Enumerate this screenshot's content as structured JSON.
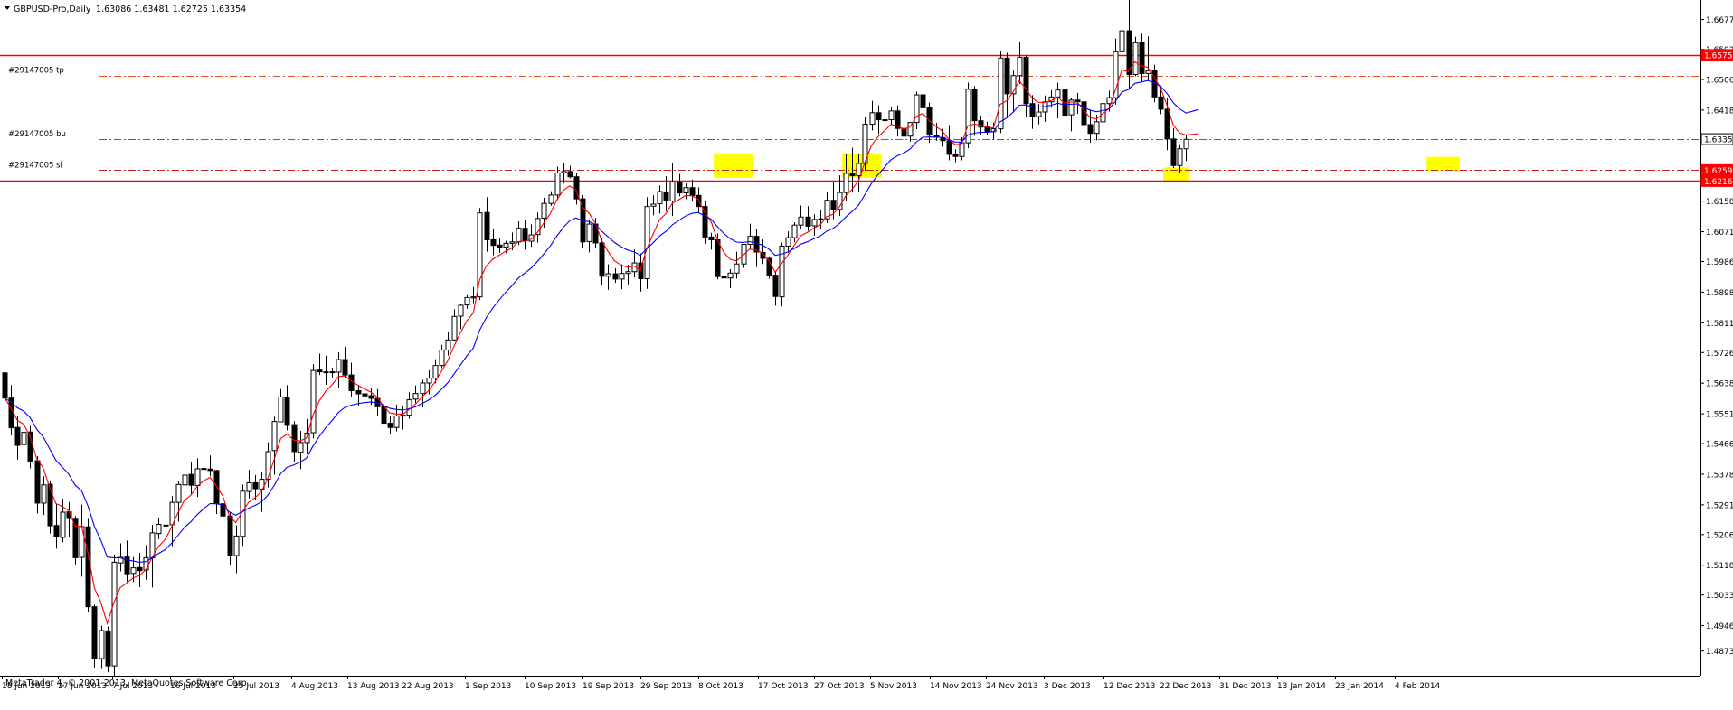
{
  "window": {
    "symbol_label": "GBPUSD-Pro,Daily",
    "ohlc_readout": "1.63086 1.63481 1.62725 1.63354",
    "copyright": "MetaTrader 4, © 2001-2013, MetaQuotes Software Corp."
  },
  "colors": {
    "background": "#ffffff",
    "candle": "#000000",
    "ma_fast": "#ff0000",
    "ma_slow": "#0000ff",
    "hline": "#ff0000",
    "tp_line": "#e05020",
    "bid_line": "#2a8a2a",
    "sl_line": "#cc2020",
    "highlight": "#ffff00",
    "price_badge": "#ff0000"
  },
  "chart_data": {
    "type": "candlestick",
    "symbol": "GBPUSD-Pro",
    "timeframe": "Daily",
    "y_range": [
      1.4803,
      1.6733
    ],
    "y_ticks": [
      "1.66775",
      "1.65920",
      "1.65060",
      "1.64185",
      "1.63354",
      "1.62591",
      "1.62160",
      "1.61585",
      "1.60710",
      "1.59860",
      "1.58985",
      "1.58110",
      "1.57260",
      "1.56385",
      "1.55510",
      "1.54660",
      "1.53785",
      "1.52910",
      "1.52060",
      "1.51185",
      "1.50335",
      "1.49460",
      "1.48735"
    ],
    "x_ticks": [
      "18 Jun 2013",
      "27 Jun 2013",
      "7 Jul 2013",
      "16 Jul 2013",
      "25 Jul 2013",
      "4 Aug 2013",
      "13 Aug 2013",
      "22 Aug 2013",
      "1 Sep 2013",
      "10 Sep 2013",
      "19 Sep 2013",
      "29 Sep 2013",
      "8 Oct 2013",
      "17 Oct 2013",
      "27 Oct 2013",
      "5 Nov 2013",
      "14 Nov 2013",
      "24 Nov 2013",
      "3 Dec 2013",
      "12 Dec 2013",
      "22 Dec 2013",
      "31 Dec 2013",
      "13 Jan 2014",
      "23 Jan 2014",
      "4 Feb 2014"
    ],
    "horizontal_lines": [
      {
        "price": 1.65759,
        "style": "solid",
        "badge": "1.65759"
      },
      {
        "price": 1.6216,
        "style": "solid",
        "badge": "1.62160"
      },
      {
        "price": 1.6517,
        "style": "dashdot",
        "label": "#29147005 tp"
      },
      {
        "price": 1.63354,
        "style": "dashdot",
        "label": "#29147005 bu",
        "badge": "1.63354"
      },
      {
        "price": 1.6247,
        "style": "dashdot",
        "label": "#29147005 sl",
        "badge": "1.62591"
      }
    ],
    "moving_averages": [
      {
        "period": 5,
        "color_key": "ma_fast"
      },
      {
        "period": 14,
        "color_key": "ma_slow"
      }
    ],
    "highlight_zones": [
      {
        "from_index": 111,
        "to_index": 116,
        "low": 1.6225,
        "high": 1.6295
      },
      {
        "from_index": 131,
        "to_index": 136,
        "low": 1.6225,
        "high": 1.6295
      },
      {
        "from_index": 181,
        "to_index": 184,
        "low": 1.6215,
        "high": 1.6255
      },
      {
        "from_index": 222,
        "to_index": 226,
        "low": 1.6245,
        "high": 1.6285
      }
    ],
    "candles": [
      [
        1.5668,
        1.572,
        1.5585,
        1.5596
      ],
      [
        1.5596,
        1.5633,
        1.5489,
        1.5511
      ],
      [
        1.5512,
        1.5546,
        1.542,
        1.5461
      ],
      [
        1.5463,
        1.553,
        1.5416,
        1.5498
      ],
      [
        1.5499,
        1.5516,
        1.5395,
        1.5416
      ],
      [
        1.5417,
        1.543,
        1.5266,
        1.5296
      ],
      [
        1.5296,
        1.5373,
        1.5262,
        1.5348
      ],
      [
        1.535,
        1.536,
        1.5209,
        1.5231
      ],
      [
        1.5232,
        1.5295,
        1.5166,
        1.5199
      ],
      [
        1.5198,
        1.5308,
        1.5184,
        1.527
      ],
      [
        1.5271,
        1.5299,
        1.52,
        1.5252
      ],
      [
        1.525,
        1.5259,
        1.5121,
        1.514
      ],
      [
        1.5141,
        1.5292,
        1.5086,
        1.5229
      ],
      [
        1.5228,
        1.5251,
        1.4985,
        1.5
      ],
      [
        1.5,
        1.5006,
        1.4825,
        1.4853
      ],
      [
        1.4852,
        1.4946,
        1.4822,
        1.4932
      ],
      [
        1.4931,
        1.4944,
        1.4813,
        1.4831
      ],
      [
        1.4831,
        1.5149,
        1.4798,
        1.5127
      ],
      [
        1.5125,
        1.5181,
        1.5101,
        1.5141
      ],
      [
        1.5142,
        1.5189,
        1.5071,
        1.5094
      ],
      [
        1.5095,
        1.5142,
        1.5071,
        1.5111
      ],
      [
        1.5112,
        1.5154,
        1.5056,
        1.5103
      ],
      [
        1.5105,
        1.5176,
        1.5077,
        1.514
      ],
      [
        1.514,
        1.5234,
        1.5055,
        1.5211
      ],
      [
        1.5209,
        1.5254,
        1.5193,
        1.5235
      ],
      [
        1.5233,
        1.5242,
        1.5186,
        1.5231
      ],
      [
        1.5234,
        1.5316,
        1.5173,
        1.5298
      ],
      [
        1.5298,
        1.5358,
        1.5243,
        1.5349
      ],
      [
        1.5348,
        1.5398,
        1.5274,
        1.5376
      ],
      [
        1.5378,
        1.5413,
        1.5321,
        1.5347
      ],
      [
        1.5346,
        1.5424,
        1.5314,
        1.5394
      ],
      [
        1.5395,
        1.5423,
        1.537,
        1.5392
      ],
      [
        1.5393,
        1.5432,
        1.5373,
        1.5389
      ],
      [
        1.5389,
        1.5391,
        1.5265,
        1.5294
      ],
      [
        1.5294,
        1.5315,
        1.5234,
        1.5259
      ],
      [
        1.5259,
        1.5271,
        1.5119,
        1.5147
      ],
      [
        1.5146,
        1.5232,
        1.5096,
        1.5202
      ],
      [
        1.5201,
        1.5349,
        1.5174,
        1.533
      ],
      [
        1.5329,
        1.5391,
        1.5309,
        1.5354
      ],
      [
        1.5354,
        1.5376,
        1.5304,
        1.5337
      ],
      [
        1.5336,
        1.5385,
        1.5271,
        1.5364
      ],
      [
        1.5364,
        1.547,
        1.5341,
        1.5443
      ],
      [
        1.5446,
        1.5543,
        1.5377,
        1.5529
      ],
      [
        1.5528,
        1.5622,
        1.5528,
        1.5599
      ],
      [
        1.5598,
        1.5633,
        1.5504,
        1.5518
      ],
      [
        1.552,
        1.553,
        1.5414,
        1.5443
      ],
      [
        1.5441,
        1.5502,
        1.5393,
        1.5469
      ],
      [
        1.5469,
        1.5536,
        1.5435,
        1.5496
      ],
      [
        1.5497,
        1.5693,
        1.5481,
        1.5675
      ],
      [
        1.5676,
        1.5723,
        1.5662,
        1.5671
      ],
      [
        1.567,
        1.5717,
        1.5634,
        1.5671
      ],
      [
        1.5671,
        1.5683,
        1.5652,
        1.567
      ],
      [
        1.567,
        1.5727,
        1.5624,
        1.5706
      ],
      [
        1.5706,
        1.5742,
        1.5653,
        1.5662
      ],
      [
        1.5662,
        1.5697,
        1.5599,
        1.5617
      ],
      [
        1.5617,
        1.5633,
        1.5574,
        1.5608
      ],
      [
        1.5608,
        1.564,
        1.5568,
        1.5602
      ],
      [
        1.5603,
        1.5626,
        1.5576,
        1.5595
      ],
      [
        1.5595,
        1.5622,
        1.5545,
        1.5571
      ],
      [
        1.5571,
        1.5607,
        1.5469,
        1.5524
      ],
      [
        1.5524,
        1.5545,
        1.5494,
        1.5512
      ],
      [
        1.5512,
        1.5577,
        1.5501,
        1.5545
      ],
      [
        1.5545,
        1.5572,
        1.5506,
        1.5547
      ],
      [
        1.5547,
        1.5613,
        1.5537,
        1.5591
      ],
      [
        1.5593,
        1.5632,
        1.5582,
        1.5609
      ],
      [
        1.5609,
        1.5648,
        1.5569,
        1.5639
      ],
      [
        1.5639,
        1.5675,
        1.5606,
        1.5653
      ],
      [
        1.5653,
        1.5707,
        1.5638,
        1.5689
      ],
      [
        1.5689,
        1.5748,
        1.5682,
        1.5733
      ],
      [
        1.5733,
        1.5786,
        1.5717,
        1.5762
      ],
      [
        1.5762,
        1.585,
        1.5759,
        1.5829
      ],
      [
        1.583,
        1.5865,
        1.5793,
        1.5861
      ],
      [
        1.5862,
        1.589,
        1.5851,
        1.5883
      ],
      [
        1.5882,
        1.5913,
        1.5867,
        1.5885
      ],
      [
        1.5885,
        1.6139,
        1.5876,
        1.6125
      ],
      [
        1.6126,
        1.617,
        1.6014,
        1.6048
      ],
      [
        1.6048,
        1.6081,
        1.6004,
        1.6032
      ],
      [
        1.6033,
        1.6052,
        1.6011,
        1.6027
      ],
      [
        1.6027,
        1.6045,
        1.601,
        1.6038
      ],
      [
        1.6038,
        1.6069,
        1.6018,
        1.6042
      ],
      [
        1.6042,
        1.6101,
        1.6033,
        1.6081
      ],
      [
        1.6081,
        1.6104,
        1.602,
        1.6045
      ],
      [
        1.6044,
        1.6092,
        1.6028,
        1.6062
      ],
      [
        1.6063,
        1.6126,
        1.604,
        1.6109
      ],
      [
        1.611,
        1.6168,
        1.6083,
        1.6152
      ],
      [
        1.6152,
        1.6187,
        1.6145,
        1.6176
      ],
      [
        1.6176,
        1.6257,
        1.6162,
        1.6239
      ],
      [
        1.6239,
        1.6266,
        1.6209,
        1.6243
      ],
      [
        1.6243,
        1.626,
        1.6224,
        1.6228
      ],
      [
        1.6228,
        1.624,
        1.6149,
        1.6165
      ],
      [
        1.6165,
        1.6176,
        1.6023,
        1.6042
      ],
      [
        1.6043,
        1.6105,
        1.6012,
        1.6093
      ],
      [
        1.6093,
        1.6111,
        1.6026,
        1.6039
      ],
      [
        1.6039,
        1.6053,
        1.592,
        1.5944
      ],
      [
        1.5944,
        1.5978,
        1.5905,
        1.5951
      ],
      [
        1.5951,
        1.5967,
        1.5925,
        1.5936
      ],
      [
        1.5936,
        1.5978,
        1.5907,
        1.5952
      ],
      [
        1.5952,
        1.5977,
        1.5921,
        1.5957
      ],
      [
        1.5957,
        1.6021,
        1.5941,
        1.5982
      ],
      [
        1.5982,
        1.6009,
        1.59,
        1.5937
      ],
      [
        1.5937,
        1.617,
        1.5908,
        1.6143
      ],
      [
        1.6144,
        1.6175,
        1.6118,
        1.615
      ],
      [
        1.6151,
        1.6203,
        1.6123,
        1.6186
      ],
      [
        1.6185,
        1.623,
        1.6129,
        1.6159
      ],
      [
        1.6159,
        1.6267,
        1.6116,
        1.6213
      ],
      [
        1.6213,
        1.6236,
        1.6172,
        1.6182
      ],
      [
        1.6182,
        1.6209,
        1.6164,
        1.6197
      ],
      [
        1.6197,
        1.622,
        1.6157,
        1.6174
      ],
      [
        1.6175,
        1.6198,
        1.6126,
        1.6143
      ],
      [
        1.6143,
        1.616,
        1.6037,
        1.6056
      ],
      [
        1.6056,
        1.6068,
        1.602,
        1.6048
      ],
      [
        1.6048,
        1.6066,
        1.5935,
        1.5943
      ],
      [
        1.5943,
        1.596,
        1.5918,
        1.5939
      ],
      [
        1.5939,
        1.5964,
        1.591,
        1.5953
      ],
      [
        1.5953,
        1.6014,
        1.5937,
        1.5979
      ],
      [
        1.5979,
        1.6036,
        1.5968,
        1.6035
      ],
      [
        1.6035,
        1.6094,
        1.6022,
        1.6058
      ],
      [
        1.6058,
        1.6079,
        1.597,
        1.6013
      ],
      [
        1.6012,
        1.6049,
        1.5979,
        1.5995
      ],
      [
        1.5995,
        1.6001,
        1.5937,
        1.5947
      ],
      [
        1.5947,
        1.5959,
        1.586,
        1.5886
      ],
      [
        1.5885,
        1.604,
        1.5858,
        1.603
      ],
      [
        1.603,
        1.6072,
        1.6011,
        1.6054
      ],
      [
        1.6054,
        1.6098,
        1.6041,
        1.609
      ],
      [
        1.609,
        1.6146,
        1.608,
        1.6113
      ],
      [
        1.6113,
        1.6144,
        1.6073,
        1.6087
      ],
      [
        1.6088,
        1.6121,
        1.606,
        1.6106
      ],
      [
        1.6106,
        1.6132,
        1.6078,
        1.6108
      ],
      [
        1.6108,
        1.6183,
        1.6096,
        1.6161
      ],
      [
        1.6161,
        1.6213,
        1.6107,
        1.6135
      ],
      [
        1.6135,
        1.6232,
        1.6116,
        1.6183
      ],
      [
        1.6183,
        1.6293,
        1.6158,
        1.6238
      ],
      [
        1.6238,
        1.6311,
        1.6183,
        1.6231
      ],
      [
        1.6231,
        1.6294,
        1.6186,
        1.6266
      ],
      [
        1.6266,
        1.6399,
        1.6246,
        1.6378
      ],
      [
        1.6378,
        1.6445,
        1.636,
        1.6411
      ],
      [
        1.6411,
        1.6432,
        1.635,
        1.6391
      ],
      [
        1.6391,
        1.6434,
        1.6383,
        1.6391
      ],
      [
        1.6391,
        1.6428,
        1.6378,
        1.6416
      ],
      [
        1.6416,
        1.6432,
        1.6343,
        1.6366
      ],
      [
        1.6366,
        1.6388,
        1.6322,
        1.6344
      ],
      [
        1.6344,
        1.6384,
        1.6328,
        1.6383
      ],
      [
        1.6383,
        1.6471,
        1.6364,
        1.6462
      ],
      [
        1.6462,
        1.6469,
        1.641,
        1.6425
      ],
      [
        1.6425,
        1.644,
        1.6325,
        1.6347
      ],
      [
        1.6347,
        1.6382,
        1.6331,
        1.6341
      ],
      [
        1.634,
        1.6365,
        1.6314,
        1.6331
      ],
      [
        1.6331,
        1.6376,
        1.6275,
        1.6292
      ],
      [
        1.6292,
        1.6307,
        1.627,
        1.6286
      ],
      [
        1.6286,
        1.6341,
        1.6275,
        1.6325
      ],
      [
        1.6325,
        1.6497,
        1.631,
        1.6478
      ],
      [
        1.6478,
        1.6487,
        1.6345,
        1.6388
      ],
      [
        1.6388,
        1.6403,
        1.6346,
        1.637
      ],
      [
        1.637,
        1.6385,
        1.6348,
        1.6357
      ],
      [
        1.6357,
        1.6383,
        1.6334,
        1.6365
      ],
      [
        1.6365,
        1.6588,
        1.6353,
        1.6567
      ],
      [
        1.6567,
        1.6582,
        1.6397,
        1.6465
      ],
      [
        1.6465,
        1.6531,
        1.6412,
        1.6517
      ],
      [
        1.6517,
        1.6614,
        1.6493,
        1.6569
      ],
      [
        1.6569,
        1.6575,
        1.64,
        1.6437
      ],
      [
        1.6437,
        1.6461,
        1.6365,
        1.64
      ],
      [
        1.64,
        1.6436,
        1.6378,
        1.6413
      ],
      [
        1.6413,
        1.646,
        1.6385,
        1.6442
      ],
      [
        1.6442,
        1.6476,
        1.6425,
        1.6456
      ],
      [
        1.6456,
        1.6497,
        1.6395,
        1.6476
      ],
      [
        1.6476,
        1.651,
        1.6379,
        1.6404
      ],
      [
        1.6405,
        1.6454,
        1.6358,
        1.6447
      ],
      [
        1.6447,
        1.6468,
        1.6408,
        1.6442
      ],
      [
        1.6442,
        1.6451,
        1.6364,
        1.6377
      ],
      [
        1.6377,
        1.642,
        1.6325,
        1.6352
      ],
      [
        1.6352,
        1.6405,
        1.6332,
        1.6385
      ],
      [
        1.6385,
        1.6445,
        1.6366,
        1.6437
      ],
      [
        1.6437,
        1.6474,
        1.6414,
        1.6454
      ],
      [
        1.6454,
        1.6623,
        1.6434,
        1.6585
      ],
      [
        1.6585,
        1.6665,
        1.6456,
        1.6645
      ],
      [
        1.6645,
        1.6735,
        1.6477,
        1.652
      ],
      [
        1.652,
        1.6628,
        1.6515,
        1.6611
      ],
      [
        1.6611,
        1.6637,
        1.6499,
        1.6523
      ],
      [
        1.6523,
        1.6629,
        1.6501,
        1.6531
      ],
      [
        1.6531,
        1.6548,
        1.6441,
        1.6456
      ],
      [
        1.6456,
        1.6489,
        1.6407,
        1.6421
      ],
      [
        1.6421,
        1.6454,
        1.6304,
        1.6336
      ],
      [
        1.6336,
        1.6367,
        1.6253,
        1.626
      ],
      [
        1.626,
        1.6321,
        1.6238,
        1.6308
      ],
      [
        1.6308,
        1.6348,
        1.6273,
        1.6335
      ]
    ]
  }
}
